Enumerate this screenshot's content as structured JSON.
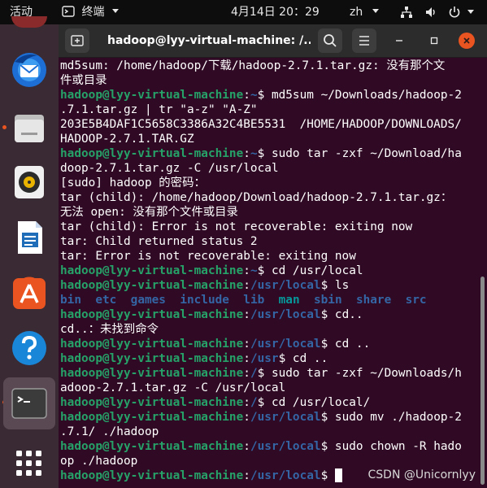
{
  "topbar": {
    "activities": "活动",
    "app_menu": "终端",
    "clock": "4月14日  20：29",
    "input_method": "zh"
  },
  "window": {
    "title": "hadoop@lyy-virtual-machine: /..."
  },
  "terminal": {
    "user": "hadoop@lyy-virtual-machine",
    "lines": [
      {
        "out": "md5sum: /home/hadoop/下载/hadoop-2.7.1.tar.gz: 没有那个文"
      },
      {
        "out": "件或目录"
      },
      {
        "user": "hadoop@lyy-virtual-machine",
        "path": "~",
        "cmd": " md5sum ~/Downloads/hadoop-2"
      },
      {
        "out": ".7.1.tar.gz | tr \"a-z\" \"A-Z\""
      },
      {
        "out": "203E5B4DAF1C5658C3386A32C4BE5531  /HOME/HADOOP/DOWNLOADS/"
      },
      {
        "out": "HADOOP-2.7.1.TAR.GZ"
      },
      {
        "user": "hadoop@lyy-virtual-machine",
        "path": "~",
        "cmd": " sudo tar -zxf ~/Download/ha"
      },
      {
        "out": "doop-2.7.1.tar.gz -C /usr/local"
      },
      {
        "out": "[sudo] hadoop 的密码："
      },
      {
        "out": "tar (child): /home/hadoop/Download/hadoop-2.7.1.tar.gz："
      },
      {
        "out": "无法 open: 没有那个文件或目录"
      },
      {
        "out": "tar (child): Error is not recoverable: exiting now"
      },
      {
        "out": "tar: Child returned status 2"
      },
      {
        "out": "tar: Error is not recoverable: exiting now"
      },
      {
        "user": "hadoop@lyy-virtual-machine",
        "path": "~",
        "cmd": " cd /usr/local"
      },
      {
        "user": "hadoop@lyy-virtual-machine",
        "path": "/usr/local",
        "cmd": " ls"
      },
      {
        "ls": [
          "bin",
          "etc",
          "games",
          "include",
          "lib",
          "man",
          "sbin",
          "share",
          "src"
        ]
      },
      {
        "user": "hadoop@lyy-virtual-machine",
        "path": "/usr/local",
        "cmd": " cd.."
      },
      {
        "out": "cd..：未找到命令"
      },
      {
        "user": "hadoop@lyy-virtual-machine",
        "path": "/usr/local",
        "cmd": " cd .."
      },
      {
        "user": "hadoop@lyy-virtual-machine",
        "path": "/usr",
        "cmd": " cd .."
      },
      {
        "user": "hadoop@lyy-virtual-machine",
        "path": "/",
        "cmd": " sudo tar -zxf ~/Downloads/h"
      },
      {
        "out": "adoop-2.7.1.tar.gz -C /usr/local"
      },
      {
        "user": "hadoop@lyy-virtual-machine",
        "path": "/",
        "cmd": " cd /usr/local/"
      },
      {
        "user": "hadoop@lyy-virtual-machine",
        "path": "/usr/local",
        "cmd": " sudo mv ./hadoop-2"
      },
      {
        "out": ".7.1/ ./hadoop"
      },
      {
        "user": "hadoop@lyy-virtual-machine",
        "path": "/usr/local",
        "cmd": " sudo chown -R hado"
      },
      {
        "out": "op ./hadoop"
      },
      {
        "user": "hadoop@lyy-virtual-machine",
        "path": "/usr/local",
        "cmd": " ",
        "cursor": true
      }
    ]
  },
  "watermark": "CSDN @Unicornlyy",
  "icons": {
    "dock": [
      "thunderbird-icon",
      "files-icon",
      "rhythmbox-icon",
      "libreoffice-writer-icon",
      "app-center-icon",
      "help-icon",
      "terminal-icon",
      "show-apps-icon"
    ],
    "titlebar": [
      "new-tab-icon",
      "search-icon",
      "hamburger-menu-icon",
      "minimize-icon",
      "maximize-icon",
      "close-icon"
    ]
  },
  "colors": {
    "terminal_bg": "#300a24",
    "prompt_user": "#26a269",
    "prompt_path": "#3465a4",
    "ls_special": "#06989a",
    "close_button": "#e95420"
  }
}
